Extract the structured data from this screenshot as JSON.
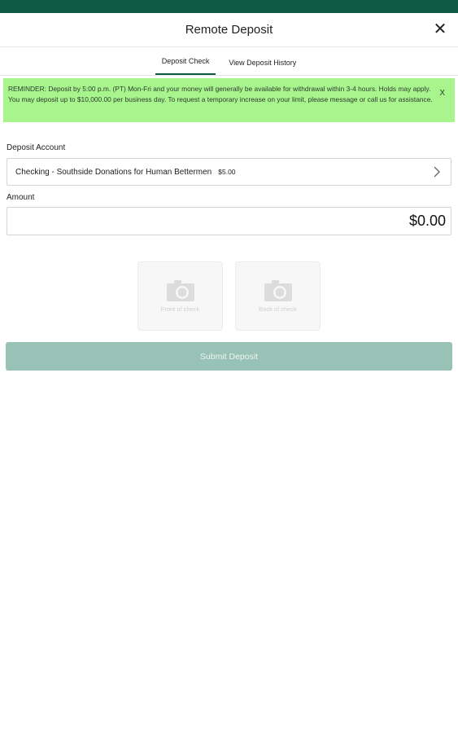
{
  "header": {
    "title": "Remote Deposit",
    "close_icon": "close-icon"
  },
  "tabs": [
    {
      "label": "Deposit Check",
      "active": true
    },
    {
      "label": "View Deposit History",
      "active": false
    }
  ],
  "reminder": {
    "text": "REMINDER: Deposit by 5:00 p.m. (PT) Mon-Fri and your money will generally be available for withdrawal within 3-4 hours. Holds may apply. You may deposit up to $10,000.00 per business day. To request a temporary increase on your limit, please message or call us for assistance.",
    "dismiss_label": "X"
  },
  "deposit_account": {
    "label": "Deposit Account",
    "account_name": "Checking - Southside Donations for Human Bettermen",
    "balance": "$5.00"
  },
  "amount": {
    "label": "Amount",
    "value": "$0.00"
  },
  "checks": {
    "front_label": "Front of check",
    "back_label": "Back of check"
  },
  "submit_label": "Submit Deposit",
  "colors": {
    "brand": "#0f5a45",
    "reminder_bg": "#a8f58e",
    "submit_bg": "#99c2b6"
  }
}
